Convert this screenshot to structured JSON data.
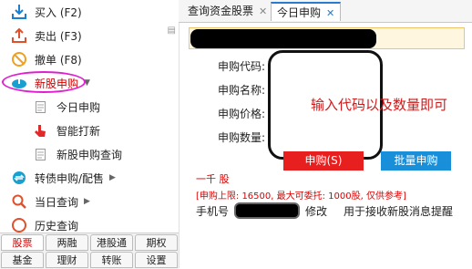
{
  "sidebar": {
    "items": [
      {
        "icon": "download-arrow-icon",
        "label": "买入 (F2)",
        "color": "#1a7fd0"
      },
      {
        "icon": "upload-arrow-icon",
        "label": "卖出 (F3)",
        "color": "#e0502a"
      },
      {
        "icon": "cancel-circle-icon",
        "label": "撤单 (F8)",
        "color": "#f0a020"
      },
      {
        "icon": "new-stock-icon",
        "label": "新股申购",
        "color": "#1aa0d0"
      },
      {
        "icon": "document-icon",
        "label": "今日申购"
      },
      {
        "icon": "finger-tap-icon",
        "label": "智能打新"
      },
      {
        "icon": "document-icon",
        "label": "新股申购查询"
      },
      {
        "icon": "exchange-icon",
        "label": "转债申购/配售"
      },
      {
        "icon": "search-icon",
        "label": "当日查询"
      },
      {
        "icon": "history-icon",
        "label": "历史查询"
      }
    ]
  },
  "bottom_tabs": {
    "row1": [
      "股票",
      "两融",
      "港股通",
      "期权"
    ],
    "row2": [
      "基金",
      "理财",
      "转账",
      "设置"
    ]
  },
  "tabs": [
    {
      "label": "查询资金股票"
    },
    {
      "label": "今日申购"
    }
  ],
  "form": {
    "code_label": "申购代码:",
    "name_label": "申购名称:",
    "price_label": "申购价格:",
    "qty_label": "申购数量:",
    "hint": "输入代码以及数量即可",
    "buy_button": "申购(S)",
    "batch_button": "批量申购",
    "qty_unit": "一千 股",
    "limit": "[申购上限: 16500, 最大可委托: 1000股, 仅供参考]",
    "phone_label": "手机号",
    "modify": "修改",
    "phone_desc": "用于接收新股消息提醒"
  },
  "colors": {
    "accent_red": "#e81f1f",
    "accent_blue": "#1a8fd9",
    "active_tab_text": "#d00000"
  }
}
